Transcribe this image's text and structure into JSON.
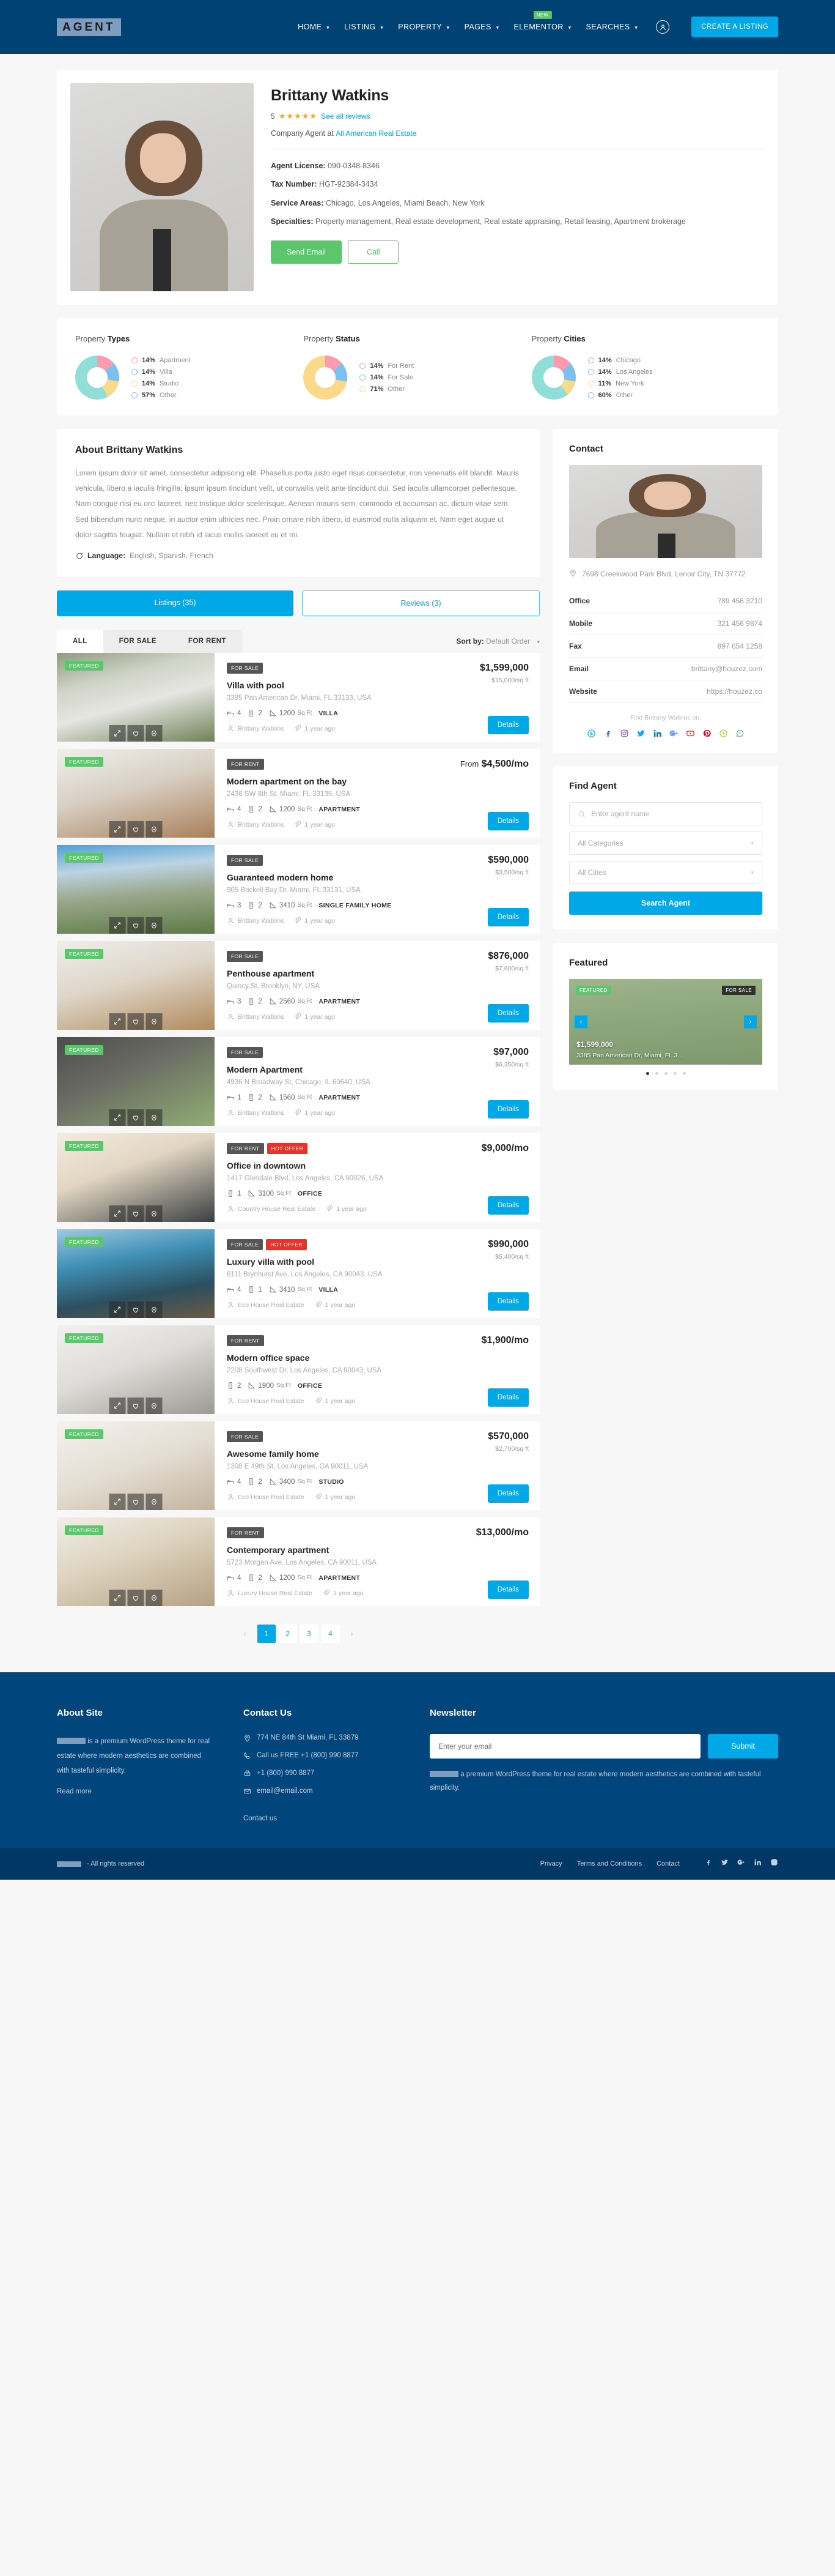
{
  "header": {
    "logo": "AGENT",
    "nav": [
      {
        "label": "HOME",
        "caret": true,
        "badge": null
      },
      {
        "label": "LISTING",
        "caret": true,
        "badge": null
      },
      {
        "label": "PROPERTY",
        "caret": true,
        "badge": null
      },
      {
        "label": "PAGES",
        "caret": true,
        "badge": null
      },
      {
        "label": "ELEMENTOR",
        "caret": true,
        "badge": "NEW"
      },
      {
        "label": "SEARCHES",
        "caret": true,
        "badge": null
      }
    ],
    "cta": "CREATE A LISTING"
  },
  "agent": {
    "name": "Brittany Watkins",
    "rating": "5",
    "stars": "★★★★★",
    "reviews_link": "See all reviews",
    "company_prefix": "Company Agent at",
    "company": "All American Real Estate",
    "license_label": "Agent License:",
    "license": "090-0348-8346",
    "tax_label": "Tax Number:",
    "tax": "HGT-92384-3434",
    "areas_label": "Service Areas:",
    "areas": "Chicago, Los Angeles, Miami Beach, New York",
    "specialties_label": "Specialties:",
    "specialties": "Property management, Real estate development, Real estate appraising, Retail leasing, Apartment brokerage",
    "btn_email": "Send Email",
    "btn_call": "Call"
  },
  "chart_data": [
    {
      "type": "pie",
      "title": "Property Types",
      "title_prefix": "Property",
      "title_bold": "Types",
      "categories": [
        "Apartment",
        "Villa",
        "Studio",
        "Other"
      ],
      "values": [
        14,
        14,
        14,
        57
      ],
      "labels": [
        "14%",
        "14%",
        "14%",
        "57%"
      ],
      "colors": [
        "#fc9aae",
        "#7cc0ef",
        "#fbd98b",
        "#91ddd7"
      ],
      "legend": "right"
    },
    {
      "type": "pie",
      "title": "Property Status",
      "title_prefix": "Property",
      "title_bold": "Status",
      "categories": [
        "For Rent",
        "For Sale",
        "Other"
      ],
      "values": [
        14,
        14,
        71
      ],
      "labels": [
        "14%",
        "14%",
        "71%"
      ],
      "colors": [
        "#fc9aae",
        "#7cc0ef",
        "#fbd98b"
      ],
      "legend": "right"
    },
    {
      "type": "pie",
      "title": "Property Cities",
      "title_prefix": "Property",
      "title_bold": "Cities",
      "categories": [
        "Chicago",
        "Los Angeles",
        "New York",
        "Other"
      ],
      "values": [
        14,
        14,
        11,
        60
      ],
      "labels": [
        "14%",
        "14%",
        "11%",
        "60%"
      ],
      "colors": [
        "#fc9aae",
        "#7cc0ef",
        "#fbd98b",
        "#91ddd7"
      ],
      "legend": "right"
    }
  ],
  "about": {
    "heading": "About Brittany Watkins",
    "body": "Lorem ipsum dolor sit amet, consectetur adipiscing elit. Phasellus porta justo eget risus consectetur, non venenatis elit blandit. Mauris vehicula, libero a iaculis fringilla, ipsum ipsum tincidunt velit, ut convallis velit ante tincidunt dui. Sed iaculis ullamcorper pellentesque. Nam congue nisi eu orci laoreet, nec tristique dolor scelerisque. Aenean mauris sem, commodo et accumsan ac, dictum vitae sem. Sed bibendum nunc neque, in auctor enim ultricies nec. Proin ornare nibh libero, id euismod nulla aliquam et. Nam eget augue ut dolor sagittis feugiat. Nullam et nibh id lacus mollis laoreet eu et mi.",
    "language_label": "Language:",
    "language": "English, Spanish, French"
  },
  "tabs": {
    "listings": "Listings (35)",
    "reviews": "Reviews (3)"
  },
  "filter": {
    "tabs": [
      "ALL",
      "FOR SALE",
      "FOR RENT"
    ],
    "active": "ALL",
    "sort_label": "Sort by:",
    "sort_value": "Default Order"
  },
  "listings": [
    {
      "featured": "FEATURED",
      "status": "FOR SALE",
      "hot": null,
      "title": "Villa with pool",
      "address": "3385 Pan American Dr, Miami, FL 33133, USA",
      "beds": "4",
      "baths": "2",
      "sqft": "1200",
      "sqft_unit": "Sq Ft",
      "type": "VILLA",
      "author": "Brittany Watkins",
      "time": "1 year ago",
      "price": "$1,599,000",
      "price_from": null,
      "price_sub": "$15,000/sq ft",
      "details": "Details",
      "img": "house-white-colonial"
    },
    {
      "featured": "FEATURED",
      "status": "FOR RENT",
      "hot": null,
      "title": "Modern apartment on the bay",
      "address": "2436 SW 8th St, Miami, FL 33135, USA",
      "beds": "4",
      "baths": "2",
      "sqft": "1200",
      "sqft_unit": "Sq Ft",
      "type": "APARTMENT",
      "author": "Brittany Watkins",
      "time": "1 year ago",
      "price": "$4,500/mo",
      "price_from": "From",
      "price_sub": null,
      "details": "Details",
      "img": "interior-loft-kitchen"
    },
    {
      "featured": "FEATURED",
      "status": "FOR SALE",
      "hot": null,
      "title": "Guaranteed modern home",
      "address": "905 Brickell Bay Dr, Miami, FL 33131, USA",
      "beds": "3",
      "baths": "2",
      "sqft": "3410",
      "sqft_unit": "Sq Ft",
      "type": "SINGLE FAMILY HOME",
      "author": "Brittany Watkins",
      "time": "1 year ago",
      "price": "$590,000",
      "price_from": null,
      "price_sub": "$3,500/sq ft",
      "details": "Details",
      "img": "house-gabled-garden"
    },
    {
      "featured": "FEATURED",
      "status": "FOR SALE",
      "hot": null,
      "title": "Penthouse apartment",
      "address": "Quincy St, Brooklyn, NY, USA",
      "beds": "3",
      "baths": "2",
      "sqft": "2560",
      "sqft_unit": "Sq Ft",
      "type": "APARTMENT",
      "author": "Brittany Watkins",
      "time": "1 year ago",
      "price": "$876,000",
      "price_from": null,
      "price_sub": "$7,600/sq ft",
      "details": "Details",
      "img": "interior-dining-kitchen"
    },
    {
      "featured": "FEATURED",
      "status": "FOR SALE",
      "hot": null,
      "title": "Modern Apartment",
      "address": "4936 N Broadway St, Chicago, IL 60640, USA",
      "beds": "1",
      "baths": "2",
      "sqft": "1560",
      "sqft_unit": "Sq Ft",
      "type": "APARTMENT",
      "author": "Brittany Watkins",
      "time": "1 year ago",
      "price": "$97,000",
      "price_from": null,
      "price_sub": "$6,350/sq ft",
      "details": "Details",
      "img": "interior-shelves-plants"
    },
    {
      "featured": "FEATURED",
      "status": "FOR RENT",
      "hot": "HOT OFFER",
      "title": "Office in downtown",
      "address": "1417 Glendale Blvd, Los Angeles, CA 90026, USA",
      "beds": null,
      "baths": "1",
      "sqft": "3100",
      "sqft_unit": "Sq Ft",
      "type": "OFFICE",
      "author": "Country House Real Estate",
      "time": "1 year ago",
      "price": "$9,000/mo",
      "price_from": null,
      "price_sub": null,
      "details": "Details",
      "img": "interior-office-desk"
    },
    {
      "featured": "FEATURED",
      "status": "FOR SALE",
      "hot": "HOT OFFER",
      "title": "Luxury villa with pool",
      "address": "6111 Brynhurst Ave, Los Angeles, CA 90043, USA",
      "beds": "4",
      "baths": "1",
      "sqft": "3410",
      "sqft_unit": "Sq Ft",
      "type": "VILLA",
      "author": "Eco House Real Estate",
      "time": "1 year ago",
      "price": "$990,000",
      "price_from": null,
      "price_sub": "$5,400/sq ft",
      "details": "Details",
      "img": "villa-pool-dusk"
    },
    {
      "featured": "FEATURED",
      "status": "FOR RENT",
      "hot": null,
      "title": "Modern office space",
      "address": "2208 Southwest Dr, Los Angeles, CA 90043, USA",
      "beds": null,
      "baths": "2",
      "sqft": "1900",
      "sqft_unit": "Sq Ft",
      "type": "OFFICE",
      "author": "Eco House Real Estate",
      "time": "1 year ago",
      "price": "$1,900/mo",
      "price_from": null,
      "price_sub": null,
      "details": "Details",
      "img": "interior-gallery-wall"
    },
    {
      "featured": "FEATURED",
      "status": "FOR SALE",
      "hot": null,
      "title": "Awesome family home",
      "address": "1308 E 49th St, Los Angeles, CA 90011, USA",
      "beds": "4",
      "baths": "2",
      "sqft": "3400",
      "sqft_unit": "Sq Ft",
      "type": "STUDIO",
      "author": "Eco House Real Estate",
      "time": "1 year ago",
      "price": "$570,000",
      "price_from": null,
      "price_sub": "$2,700/sq ft",
      "details": "Details",
      "img": "interior-sofa-shelf"
    },
    {
      "featured": "FEATURED",
      "status": "FOR RENT",
      "hot": null,
      "title": "Contemporary apartment",
      "address": "5723 Morgan Ave, Los Angeles, CA 90011, USA",
      "beds": "4",
      "baths": "2",
      "sqft": "1200",
      "sqft_unit": "Sq Ft",
      "type": "APARTMENT",
      "author": "Luxury House Real Estate",
      "time": "1 year ago",
      "price": "$13,000/mo",
      "price_from": null,
      "price_sub": null,
      "details": "Details",
      "img": "interior-rattan-dining"
    }
  ],
  "pagination": {
    "prev": "‹",
    "pages": [
      "1",
      "2",
      "3",
      "4"
    ],
    "active": "1",
    "next": "›"
  },
  "contact": {
    "heading": "Contact",
    "address": "7698 Creekwood Park Blvd, Lenoir City, TN 37772",
    "rows": [
      {
        "key": "Office",
        "value": "789 456 3210"
      },
      {
        "key": "Mobile",
        "value": "321 456 9874"
      },
      {
        "key": "Fax",
        "value": "897 654 1258"
      },
      {
        "key": "Email",
        "value": "brittany@houzez.com"
      },
      {
        "key": "Website",
        "value": "https://houzez.co"
      }
    ],
    "find_on": "Find Brittany Watkins on:",
    "socials": [
      "skype",
      "facebook",
      "instagram",
      "twitter",
      "linkedin",
      "googleplus",
      "youtube",
      "pinterest",
      "vimeo",
      "whatsapp"
    ]
  },
  "find_agent": {
    "heading": "Find Agent",
    "name_placeholder": "Enter agent name",
    "category_value": "All Categories",
    "city_value": "All Cities",
    "button": "Search Agent"
  },
  "featured_widget": {
    "heading": "Featured",
    "badge_featured": "FEATURED",
    "badge_status": "FOR SALE",
    "price": "$1,599,000",
    "address": "3385 Pan American Dr, Miami, FL 3...",
    "dots": 5,
    "active_dot": 0
  },
  "footer": {
    "about_heading": "About Site",
    "about_text_suffix": "is a premium WordPress theme for real estate where modern aesthetics are combined with tasteful simplicity.",
    "read_more": "Read more",
    "contact_heading": "Contact Us",
    "contact_rows": [
      {
        "icon": "location-icon",
        "text": "774 NE 84th St Miami, FL 33879"
      },
      {
        "icon": "phone-icon",
        "text": "Call us FREE +1 (800) 990 8877"
      },
      {
        "icon": "fax-icon",
        "text": "+1 (800) 990 8877"
      },
      {
        "icon": "mail-icon",
        "text": "email@email.com"
      }
    ],
    "contact_link": "Contact us",
    "newsletter_heading": "Newsletter",
    "email_placeholder": "Enter your email",
    "submit": "Submit",
    "newsletter_note_suffix": "a premium WordPress theme for real estate where modern aesthetics are combined with tasteful simplicity.",
    "copyright": "- All rights reserved",
    "bottom_links": [
      "Privacy",
      "Terms and Conditions",
      "Contact"
    ],
    "bottom_socials": [
      "facebook",
      "twitter",
      "googleplus",
      "linkedin",
      "instagram"
    ]
  },
  "colors": {
    "brand_blue": "#00a8e8",
    "navy": "#004274",
    "green": "#5bc66c",
    "red": "#e8332a",
    "star": "#f5a623"
  }
}
